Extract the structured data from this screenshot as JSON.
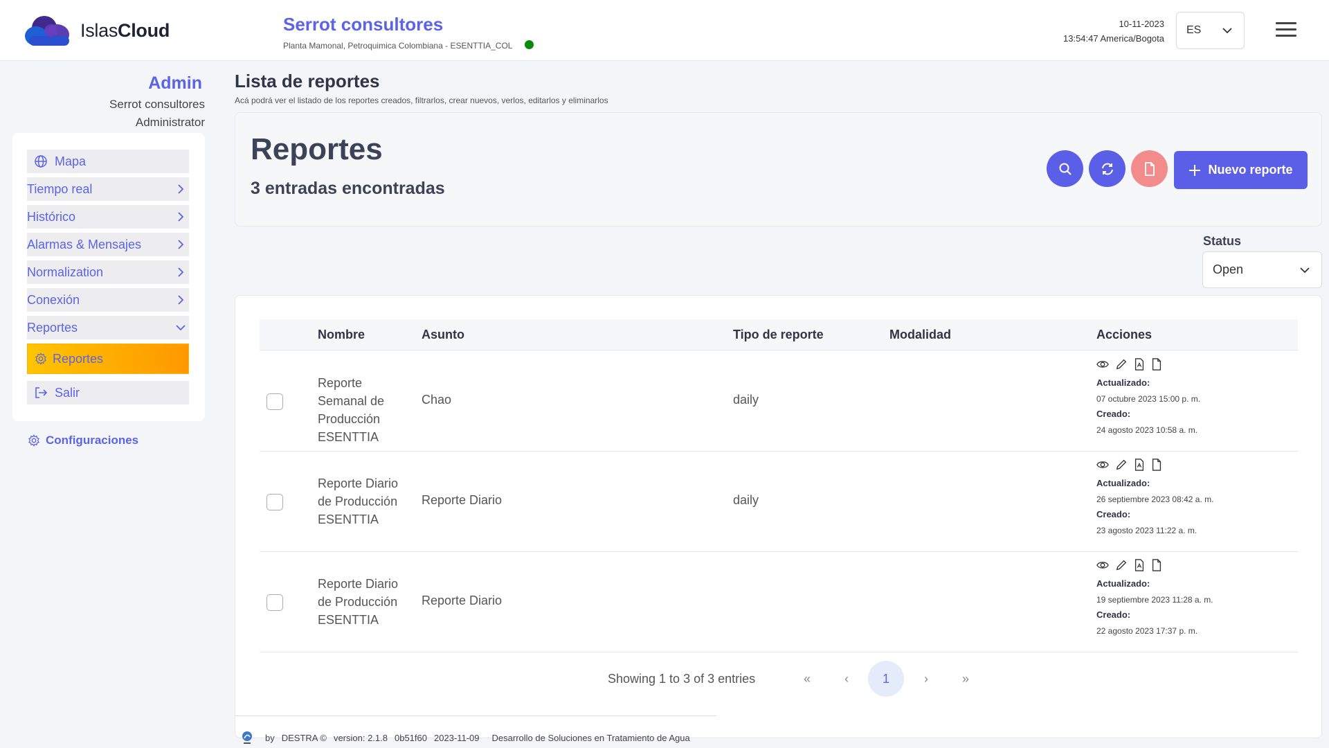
{
  "header": {
    "logo_text_light": "Islas",
    "logo_text_bold": "Cloud",
    "company_name": "Serrot consultores",
    "plant_info": "Planta Mamonal, Petroquimica Colombiana - ESENTTIA_COL",
    "date": "10-11-2023",
    "time": "13:54:47 America/Bogota",
    "language": "ES",
    "status_color": "#0a8a0a"
  },
  "user": {
    "name": "Admin",
    "company": "Serrot consultores",
    "role": "Administrator"
  },
  "sidebar": {
    "items": [
      {
        "label": "Mapa",
        "icon": "globe-icon"
      },
      {
        "label": "Tiempo real",
        "icon": "chevron-right-icon"
      },
      {
        "label": "Histórico",
        "icon": "chevron-right-icon"
      },
      {
        "label": "Alarmas & Mensajes",
        "icon": "chevron-right-icon"
      },
      {
        "label": "Normalization",
        "icon": "chevron-right-icon"
      },
      {
        "label": "Conexión",
        "icon": "chevron-right-icon"
      },
      {
        "label": "Reportes",
        "icon": "chevron-down-icon"
      }
    ],
    "active_sub_item": "Reportes",
    "logout": "Salir",
    "settings": "Configuraciones"
  },
  "main": {
    "title": "Lista de reportes",
    "description": "Acá podrá ver el listado de los reportes creados, filtrarlos, crear nuevos, verlos, editarlos y eliminarlos",
    "card_title": "Reportes",
    "entries_found": "3 entradas encontradas",
    "new_report_label": "Nuevo reporte",
    "status_label": "Status",
    "status_value": "Open",
    "accent_color": "#5b5fe8"
  },
  "table": {
    "columns": [
      "Nombre",
      "Asunto",
      "Tipo de reporte",
      "Modalidad",
      "Acciones"
    ],
    "updated_label": "Actualizado:",
    "created_label": "Creado:",
    "rows": [
      {
        "name": "Reporte Semanal de Producción ESENTTIA",
        "subject": "Chao",
        "type": "daily",
        "mode": "",
        "updated": "07 octubre 2023 15:00 p. m.",
        "created": "24 agosto 2023 10:58 a. m."
      },
      {
        "name": "Reporte Diario de Producción ESENTTIA",
        "subject": "Reporte Diario",
        "type": "daily",
        "mode": "",
        "updated": "26 septiembre 2023 08:42 a. m.",
        "created": "23 agosto 2023 11:22 a. m."
      },
      {
        "name": "Reporte Diario de Producción ESENTTIA",
        "subject": "Reporte Diario",
        "type": "",
        "mode": "",
        "updated": "19 septiembre 2023 11:28 a. m.",
        "created": "22 agosto 2023 17:37 p. m."
      }
    ]
  },
  "pagination": {
    "info": "Showing 1 to 3 of 3 entries",
    "first": "«",
    "prev": "‹",
    "current": "1",
    "next": "›",
    "last": "»"
  },
  "footer": {
    "by": "by",
    "brand": "DESTRA ©",
    "version": "version: 2.1.8",
    "commit": "0b51f60",
    "date": "2023-11-09",
    "tagline": "Desarrollo de Soluciones en Tratamiento de Agua"
  }
}
